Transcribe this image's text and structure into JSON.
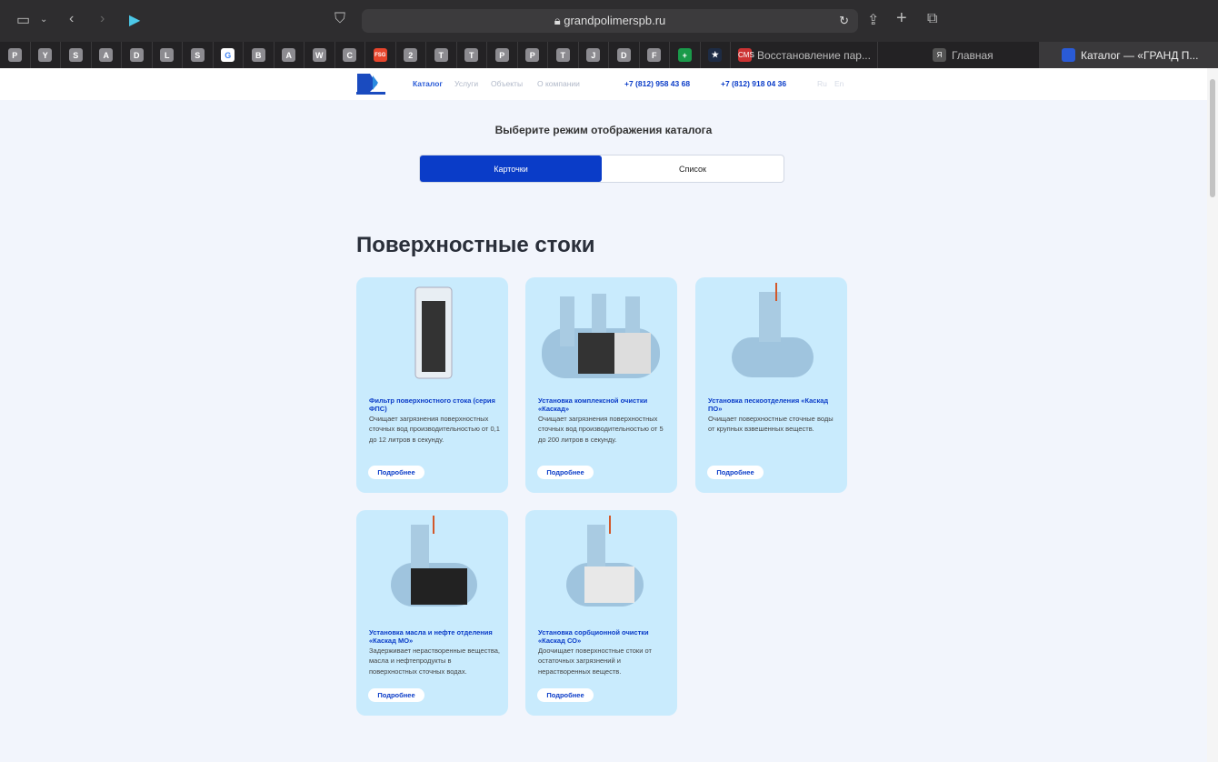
{
  "browser": {
    "url": "grandpolimerspb.ru",
    "bookmarks": [
      "P",
      "Y",
      "S",
      "A",
      "D",
      "L",
      "S",
      "G",
      "B",
      "A",
      "W",
      "C",
      "FSG",
      "2",
      "T",
      "T",
      "P",
      "P",
      "T",
      "J",
      "D",
      "F",
      "+",
      "★"
    ],
    "tabs": [
      {
        "label": "Восстановление пар...",
        "icon": "CMS"
      },
      {
        "label": "Главная",
        "icon": "Я"
      },
      {
        "label": "Каталог — «ГРАНД П...",
        "icon": ""
      }
    ]
  },
  "header": {
    "nav": [
      "Каталог",
      "Услуги",
      "Объекты",
      "О компании"
    ],
    "phones": [
      "+7 (812) 958 43 68",
      "+7 (812) 918 04 36"
    ],
    "langs": [
      "Ru",
      "En"
    ]
  },
  "mode": {
    "title": "Выберите режим отображения каталога",
    "options": [
      "Карточки",
      "Список"
    ]
  },
  "section": {
    "title": "Поверхностные стоки"
  },
  "cards": [
    {
      "title": "Фильтр поверхностного стока (серия ФПС)",
      "desc": "Очищает загрязнения поверхностных сточных вод производительностью от 0,1 до 12 литров в секунду.",
      "button": "Подробнее"
    },
    {
      "title": "Установка комплексной очистки «Каскад»",
      "desc": "Очищает загрязнения поверхностных сточных вод производительностью от 5 до 200 литров в секунду.",
      "button": "Подробнее"
    },
    {
      "title": "Установка пескоотделения «Каскад ПО»",
      "desc": "Очищает поверхностные сточные воды от крупных взвешенных веществ.",
      "button": "Подробнее"
    },
    {
      "title": "Установка масла и нефте отделения «Каскад МО»",
      "desc": "Задерживает нерастворенные вещества, масла и нефтепродукты в поверхностных сточных водах.",
      "button": "Подробнее"
    },
    {
      "title": "Установка сорбционной очистки «Каскад СО»",
      "desc": "Доочищает поверхностные стоки от остаточных загрязнений и нерастворенных веществ.",
      "button": "Подробнее"
    }
  ]
}
